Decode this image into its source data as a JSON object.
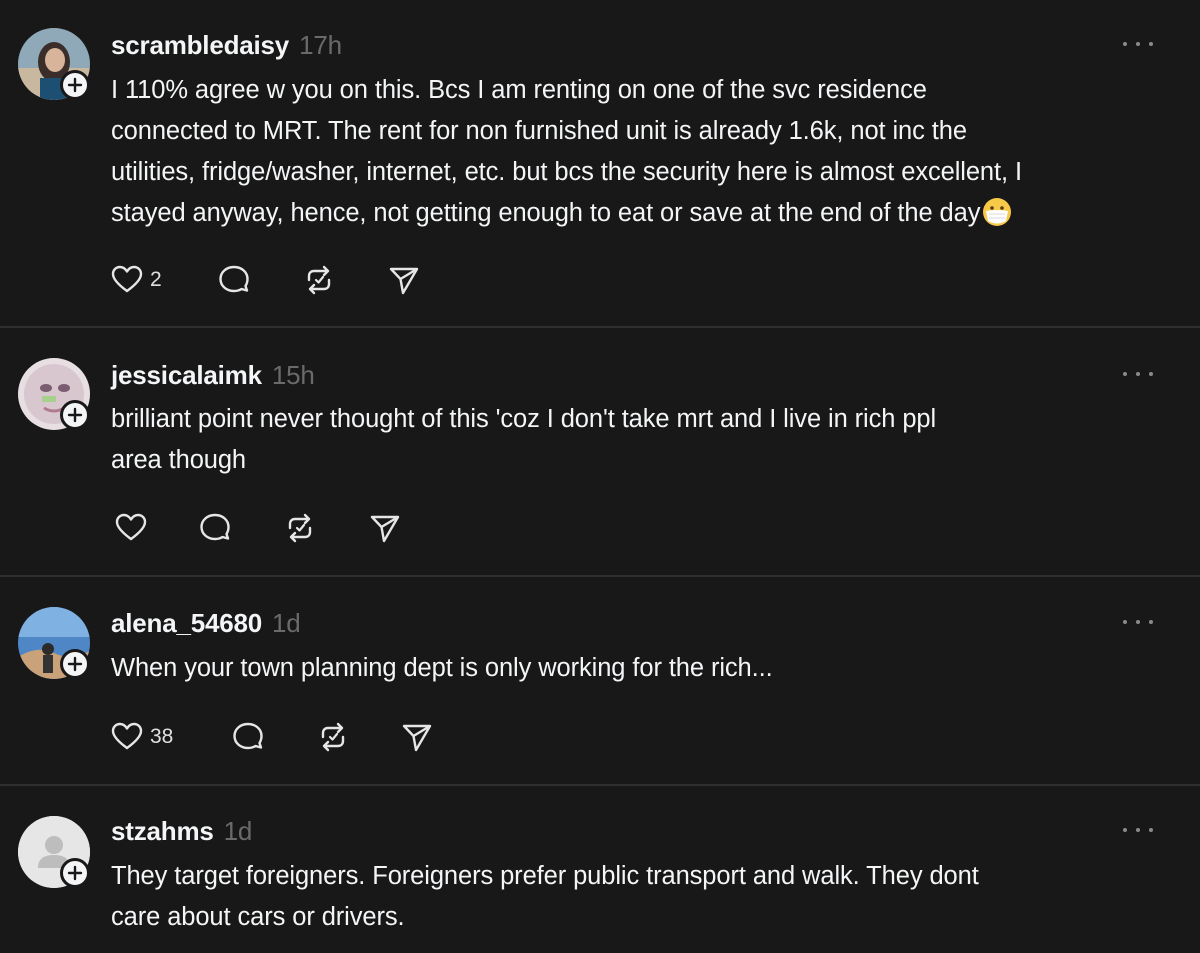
{
  "posts": [
    {
      "username": "scrambledaisy",
      "time": "17h",
      "lines": [
        "I 110% agree w you on this. Bcs I am renting on one of the svc residence",
        "connected to MRT. The rent for non furnished unit is already 1.6k, not inc the",
        "utilities, fridge/washer, internet, etc. but bcs the security here is almost excellent, I",
        "stayed anyway, hence, not getting enough to eat or save at the end of the day"
      ],
      "emoji": "face-with-medical-mask",
      "like_count": "2",
      "avatar": "photo-avatar"
    },
    {
      "username": "jessicalaimk",
      "time": "15h",
      "lines": [
        "brilliant point never thought of this 'coz I don't take mrt and I live in rich ppl",
        "area though"
      ],
      "like_count": "",
      "avatar": "photo-avatar"
    },
    {
      "username": "alena_54680",
      "time": "1d",
      "lines": [
        "When your town planning dept is only working for the rich..."
      ],
      "like_count": "38",
      "avatar": "photo-avatar"
    },
    {
      "username": "stzahms",
      "time": "1d",
      "lines": [
        "They target foreigners. Foreigners prefer public transport and walk. They dont",
        "care about cars or drivers."
      ],
      "avatar": "default-person-avatar"
    }
  ],
  "icons": {
    "like": "heart-icon",
    "reply": "comment-bubble-icon",
    "repost": "repost-icon",
    "share": "send-icon",
    "more": "more-options-icon",
    "follow": "plus-icon"
  },
  "colors": {
    "background": "#181818",
    "text": "#f3f5f7",
    "muted": "#6a6a6a",
    "divider": "#2f2f2f"
  }
}
